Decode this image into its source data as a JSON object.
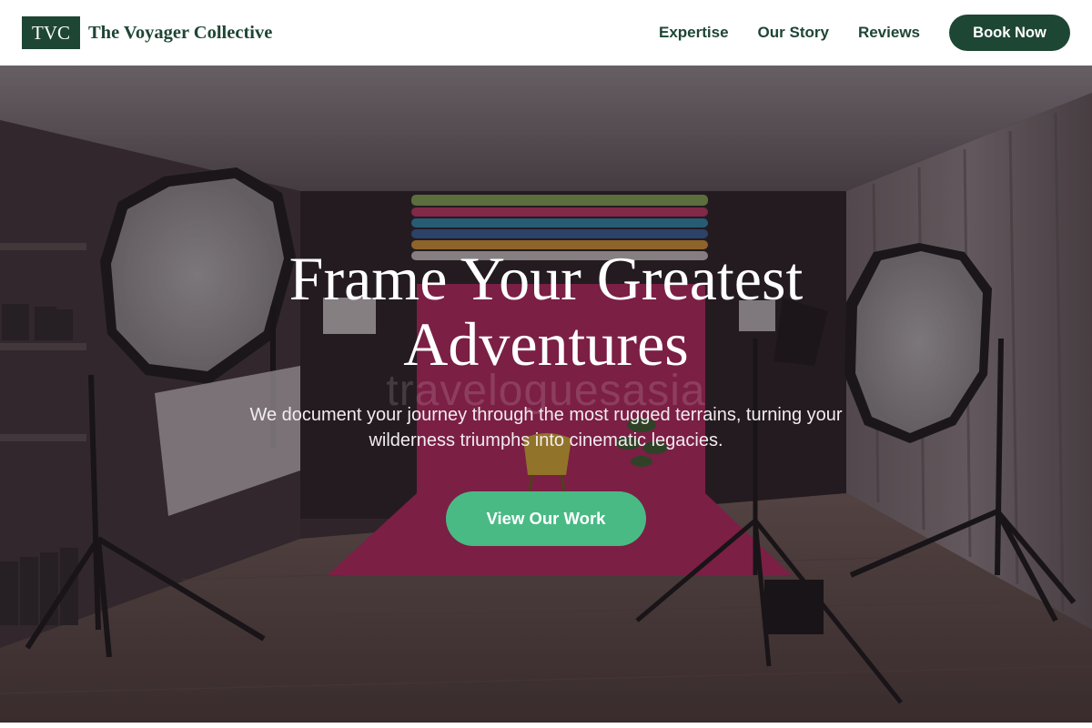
{
  "brand": {
    "mark": "TVC",
    "name": "The Voyager Collective",
    "color": "#1e4634"
  },
  "nav": {
    "links": [
      {
        "label": "Expertise"
      },
      {
        "label": "Our Story"
      },
      {
        "label": "Reviews"
      }
    ],
    "cta_label": "Book Now"
  },
  "hero": {
    "title": "Frame Your Greatest Adventures",
    "subtitle": "We document your journey through the most rugged terrains, turning your wilderness triumphs into cinematic legacies.",
    "cta_label": "View Our Work",
    "cta_color": "#4aba85",
    "background_description_icon": "photo-studio-background",
    "watermark": "traveloguesasia"
  }
}
